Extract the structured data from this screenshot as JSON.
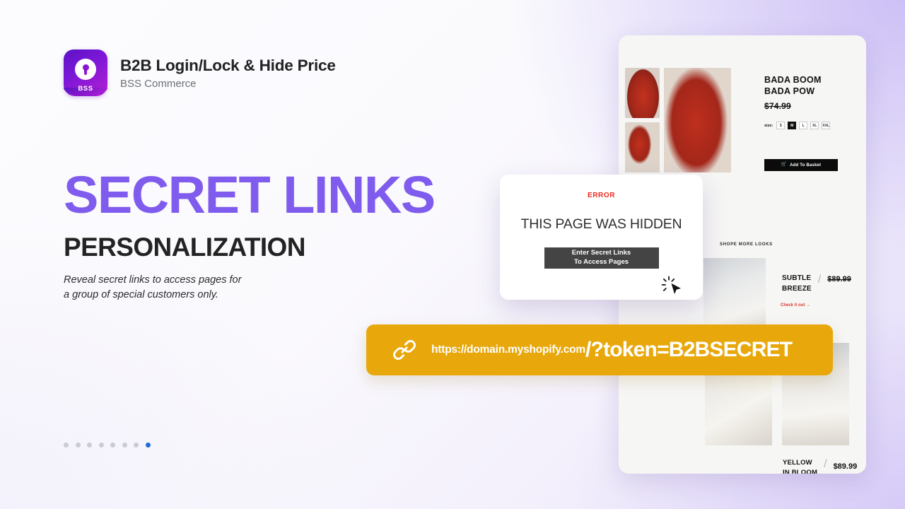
{
  "brand": {
    "title": "B2B Login/Lock & Hide Price",
    "subtitle": "BSS Commerce",
    "logo_text": "BSS",
    "logo_gradient_from": "#5b12c4",
    "logo_gradient_to": "#b31fd4"
  },
  "hero": {
    "headline": "SECRET LINKS",
    "subheadline": "PERSONALIZATION",
    "headline_color": "#7f5ced",
    "subheadline_color": "#232323",
    "tagline_line1": "Reveal secret links to access pages for",
    "tagline_line2": "a group of special customers only."
  },
  "carousel": {
    "total_dots": 8,
    "active_index": 7,
    "active_color": "#1f6fd0",
    "inactive_color": "#c9ccd1"
  },
  "modal": {
    "error_label": "ERROR",
    "error_color": "#f0281e",
    "title": "THIS PAGE WAS HIDDEN",
    "button_line1": "Enter Secret Links",
    "button_line2": "To Access Pages",
    "button_color": "#444444",
    "cursor_icon": "click-cursor-icon"
  },
  "url_banner": {
    "background": "#e8a80c",
    "icon": "link-chain-icon",
    "domain": "https://domain.myshopify.com",
    "token": "/?token=B2BSECRET"
  },
  "storefront": {
    "product": {
      "title_line1": "BADA BOOM",
      "title_line2": "BADA POW",
      "price": "$74.99",
      "size_label": "size:",
      "sizes": [
        "S",
        "M",
        "L",
        "XL",
        "XXL"
      ],
      "selected_size": "M",
      "add_to_basket": "Add To Basket",
      "cart_icon": "shopping-cart-icon"
    },
    "section_label": "SHOPE MORE LOOKS",
    "look_1": {
      "name_line1": "SUBTLE",
      "name_line2": "BREEZE",
      "divider": "/",
      "price": "$89.99",
      "cta": "Check it out →",
      "cta_color": "#e0362c"
    },
    "look_2": {
      "name_line1": "YELLOW",
      "name_line2": "IN BLOOM",
      "divider": "/",
      "price": "$89.99"
    }
  }
}
